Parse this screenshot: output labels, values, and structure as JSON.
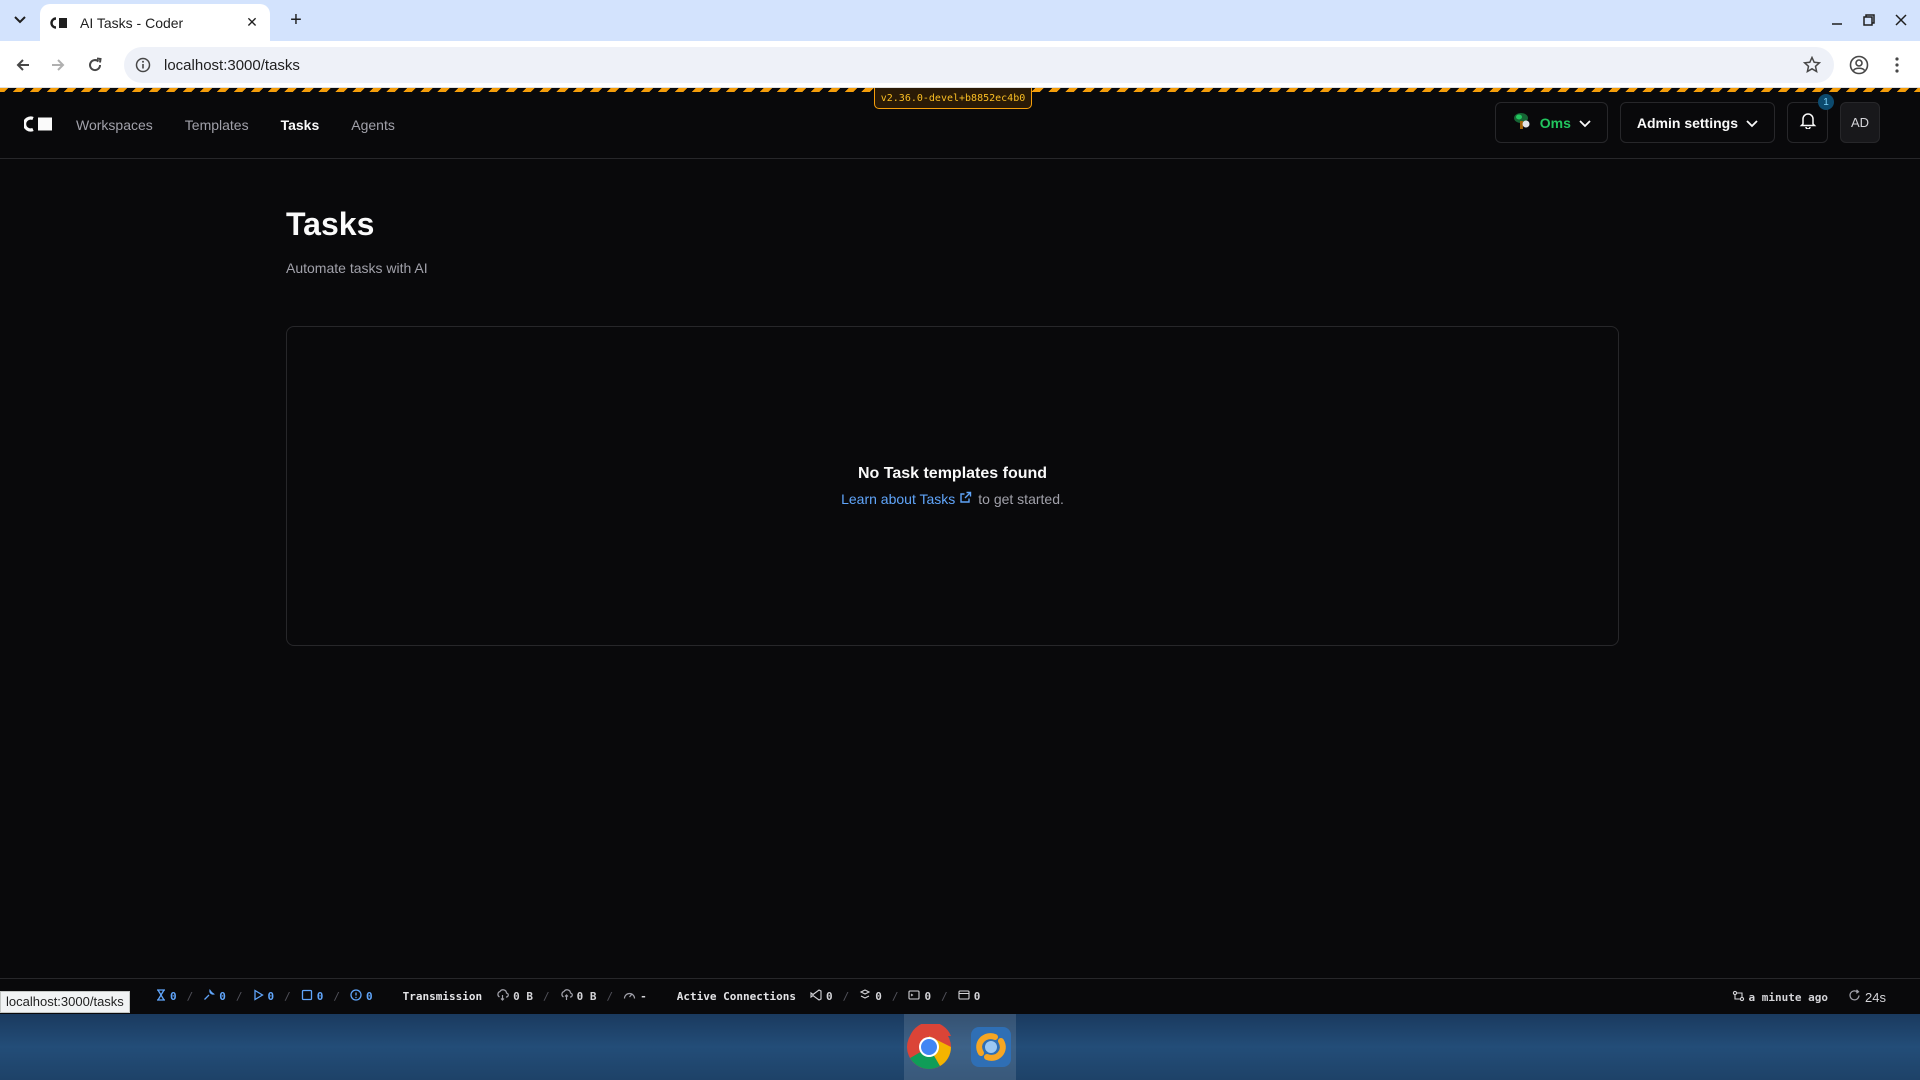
{
  "browser": {
    "tab_title": "AI Tasks - Coder",
    "url": "localhost:3000/tasks",
    "status_url": "localhost:3000/tasks"
  },
  "app": {
    "version": "v2.36.0-devel+b8852ec4b0",
    "nav": [
      {
        "label": "Workspaces",
        "active": false
      },
      {
        "label": "Templates",
        "active": false
      },
      {
        "label": "Tasks",
        "active": true
      },
      {
        "label": "Agents",
        "active": false
      }
    ],
    "org_name": "Oms",
    "admin_label": "Admin settings",
    "notification_count": "1",
    "avatar_initials": "AD"
  },
  "page": {
    "title": "Tasks",
    "subtitle": "Automate tasks with AI",
    "empty": {
      "title": "No Task templates found",
      "link_text": "Learn about Tasks",
      "suffix": "to get started."
    }
  },
  "statusbar": {
    "counts": [
      "0",
      "0",
      "0",
      "0",
      "0"
    ],
    "transmission_label": "Transmission",
    "download": "0 B",
    "upload": "0 B",
    "latency": "-",
    "connections_label": "Active Connections",
    "connections": [
      "0",
      "0",
      "0",
      "0"
    ],
    "last_updated": "a minute ago",
    "refresh": "24s"
  },
  "colors": {
    "accent_link": "#60a5fa",
    "org_green": "#22c55e",
    "dev_stripe": "#f59e0b"
  }
}
